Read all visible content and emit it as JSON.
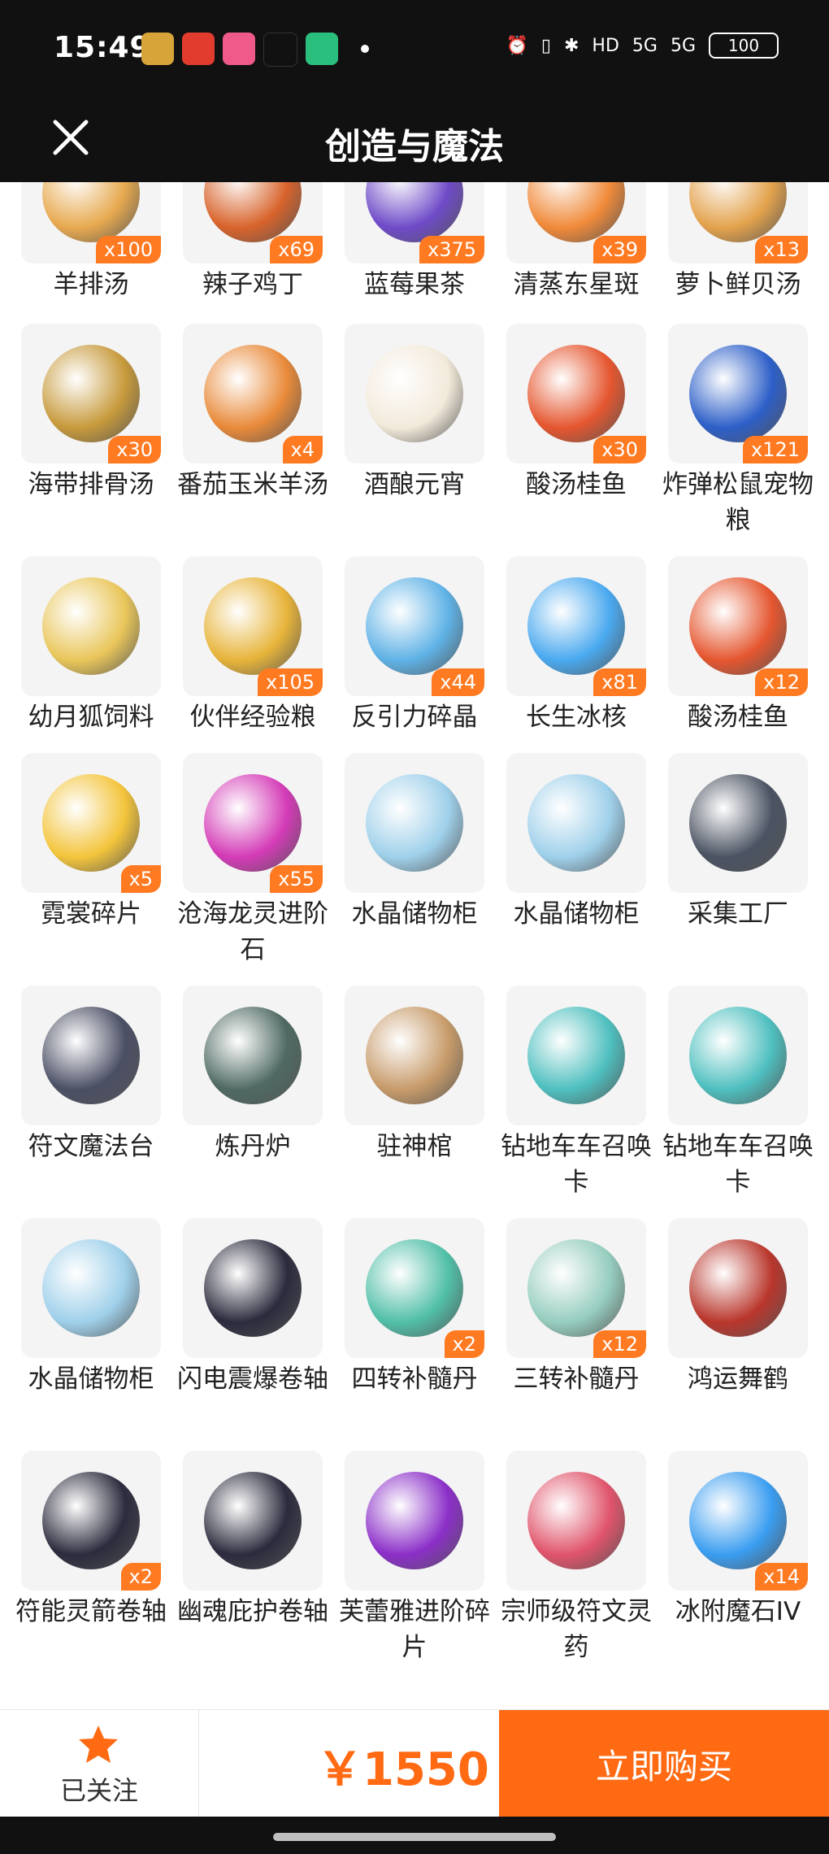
{
  "status_bar": {
    "time": "15:49",
    "right": [
      "⏰",
      "▯",
      "✱",
      "HD",
      "5G",
      "5G"
    ],
    "battery": "100"
  },
  "header": {
    "title": "创造与魔法"
  },
  "items": [
    {
      "name": "羊排汤",
      "qty": "x100",
      "color": "#e7a94f"
    },
    {
      "name": "辣子鸡丁",
      "qty": "x69",
      "color": "#d8632b"
    },
    {
      "name": "蓝莓果茶",
      "qty": "x375",
      "color": "#6f4bc8"
    },
    {
      "name": "清蒸东星斑",
      "qty": "x39",
      "color": "#f08a3a"
    },
    {
      "name": "萝卜鲜贝汤",
      "qty": "x13",
      "color": "#e3a24c"
    },
    {
      "name": "海带排骨汤",
      "qty": "x30",
      "color": "#c79a3c"
    },
    {
      "name": "番茄玉米羊汤",
      "qty": "x4",
      "color": "#e98a3a"
    },
    {
      "name": "酒酿元宵",
      "qty": "",
      "color": "#f2e9da"
    },
    {
      "name": "酸汤桂鱼",
      "qty": "x30",
      "color": "#e5562f"
    },
    {
      "name": "炸弹松鼠宠物粮",
      "qty": "x121",
      "color": "#2d5fc8"
    },
    {
      "name": "幼月狐饲料",
      "qty": "",
      "color": "#e9c65a"
    },
    {
      "name": "伙伴经验粮",
      "qty": "x105",
      "color": "#e7b43a"
    },
    {
      "name": "反引力碎晶",
      "qty": "x44",
      "color": "#5fb2e6"
    },
    {
      "name": "长生冰核",
      "qty": "x81",
      "color": "#4aa9ef"
    },
    {
      "name": "酸汤桂鱼",
      "qty": "x12",
      "color": "#e5562f"
    },
    {
      "name": "霓裳碎片",
      "qty": "x5",
      "color": "#f3c43b"
    },
    {
      "name": "沧海龙灵进阶石",
      "qty": "x55",
      "color": "#d43bb7"
    },
    {
      "name": "水晶储物柜",
      "qty": "",
      "color": "#9fd0ea"
    },
    {
      "name": "水晶储物柜",
      "qty": "",
      "color": "#9fd0ea"
    },
    {
      "name": "采集工厂",
      "qty": "",
      "color": "#4b5362"
    },
    {
      "name": "符文魔法台",
      "qty": "",
      "color": "#4b4f64"
    },
    {
      "name": "炼丹炉",
      "qty": "",
      "color": "#4f6a63"
    },
    {
      "name": "驻神棺",
      "qty": "",
      "color": "#c79b6a"
    },
    {
      "name": "钻地车车召唤卡",
      "qty": "",
      "color": "#4fbfbf"
    },
    {
      "name": "钻地车车召唤卡",
      "qty": "",
      "color": "#4fbfbf"
    },
    {
      "name": "水晶储物柜",
      "qty": "",
      "color": "#9fd0ea"
    },
    {
      "name": "闪电震爆卷轴",
      "qty": "",
      "color": "#2b2b3d"
    },
    {
      "name": "四转补髓丹",
      "qty": "x2",
      "color": "#51bfa8"
    },
    {
      "name": "三转补髓丹",
      "qty": "x12",
      "color": "#96cdbf"
    },
    {
      "name": "鸿运舞鹤",
      "qty": "",
      "color": "#b9362c"
    },
    {
      "name": "符能灵箭卷轴",
      "qty": "x2",
      "color": "#2b2b3d"
    },
    {
      "name": "幽魂庇护卷轴",
      "qty": "",
      "color": "#2b2b3d"
    },
    {
      "name": "芙蕾雅进阶碎片",
      "qty": "",
      "color": "#8b2fc8"
    },
    {
      "name": "宗师级符文灵药",
      "qty": "",
      "color": "#e0546b"
    },
    {
      "name": "冰附魔石IV",
      "qty": "x14",
      "color": "#3a9df0"
    }
  ],
  "bottom": {
    "follow_label": "已关注",
    "price": "￥1550",
    "buy_label": "立即购买"
  }
}
